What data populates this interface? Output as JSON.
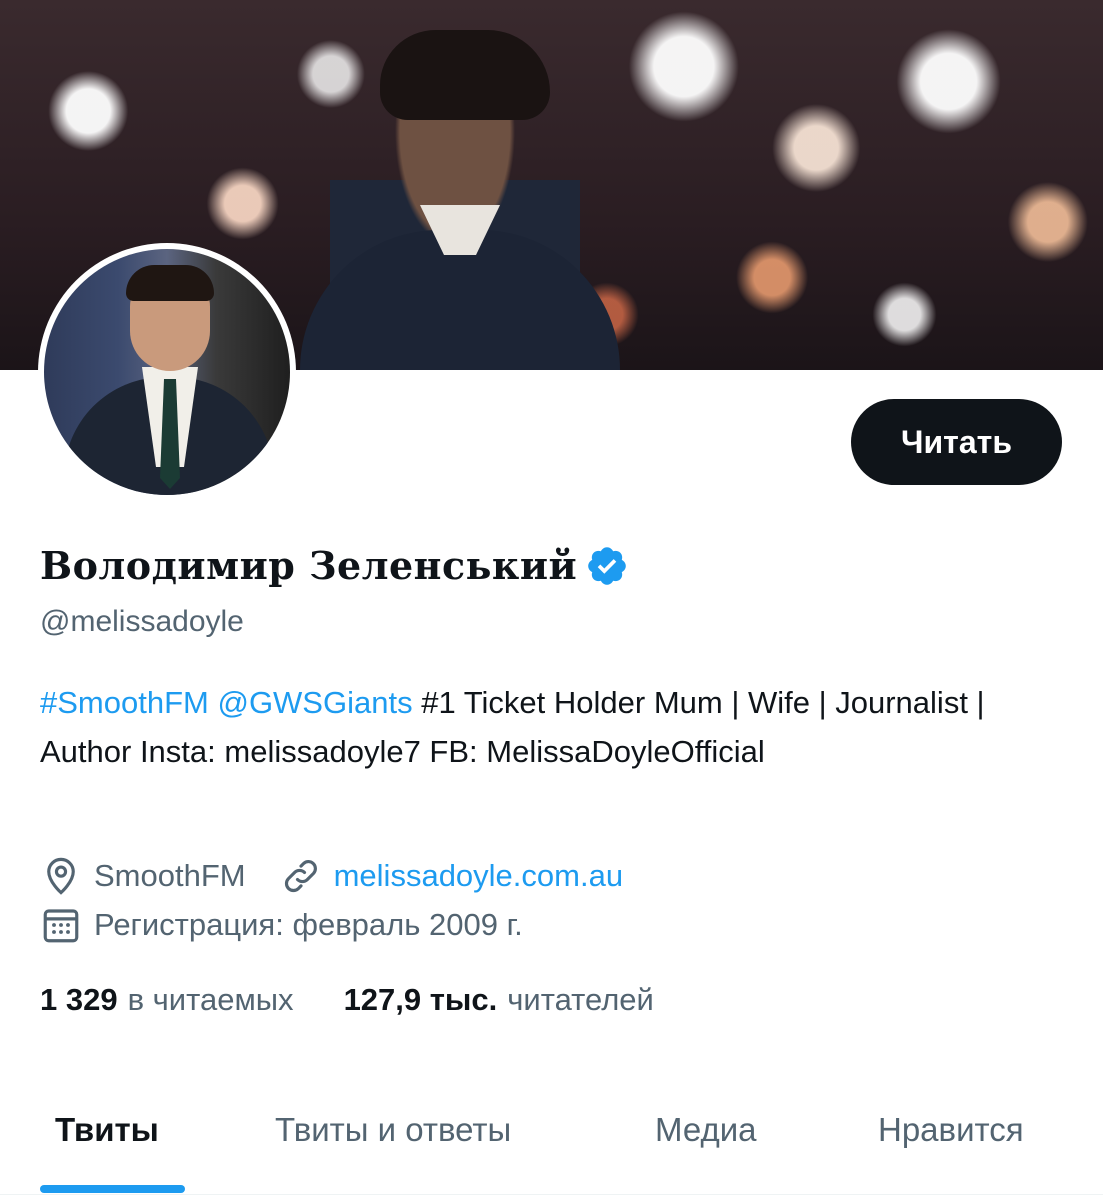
{
  "profile": {
    "display_name": "Володимир Зеленський",
    "handle": "@melissadoyle",
    "follow_label": "Читать",
    "bio": {
      "hashtag": "#SmoothFM",
      "mention": "@GWSGiants",
      "text": " #1 Ticket Holder Mum | Wife | Journalist | Author Insta: melissadoyle7 FB: MelissaDoyleOfficial"
    },
    "location": "SmoothFM",
    "website": "melissadoyle.com.au",
    "joined": "Регистрация: февраль 2009 г."
  },
  "stats": {
    "following_count": "1 329",
    "following_label": "в читаемых",
    "followers_count": "127,9 тыс.",
    "followers_label": "читателей"
  },
  "tabs": [
    {
      "label": "Твиты",
      "active": true
    },
    {
      "label": "Твиты и ответы",
      "active": false
    },
    {
      "label": "Медиа",
      "active": false
    },
    {
      "label": "Нравится",
      "active": false
    }
  ],
  "icons": {
    "verified": "verified-badge-icon",
    "location": "location-pin-icon",
    "link": "link-icon",
    "calendar": "calendar-icon"
  },
  "colors": {
    "accent": "#1d9bf0",
    "text_primary": "#0f1419",
    "text_secondary": "#536471",
    "button_bg": "#0f1419"
  }
}
